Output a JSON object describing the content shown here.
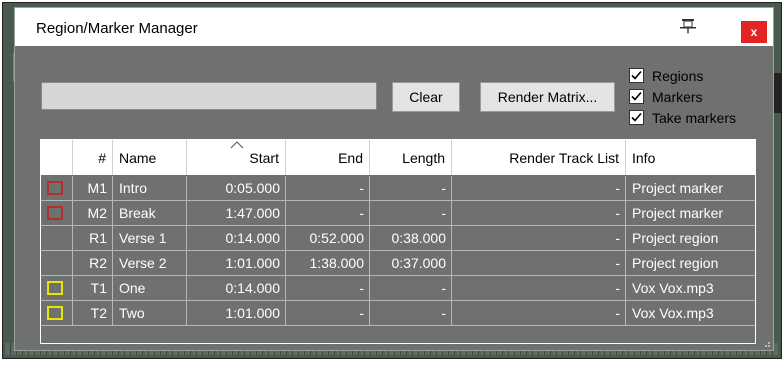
{
  "dialog": {
    "title": "Region/Marker Manager",
    "close_label": "x",
    "pin_icon": "pin-icon"
  },
  "toolbar": {
    "search_value": "",
    "clear_label": "Clear",
    "render_matrix_label": "Render Matrix..."
  },
  "filters": [
    {
      "label": "Regions",
      "checked": true
    },
    {
      "label": "Markers",
      "checked": true
    },
    {
      "label": "Take markers",
      "checked": true
    }
  ],
  "table": {
    "columns": [
      "",
      "#",
      "Name",
      "Start",
      "End",
      "Length",
      "Render Track List",
      "Info"
    ],
    "sorted_column": "Start",
    "rows": [
      {
        "swatch": "#b03030",
        "id": "M1",
        "name": "Intro",
        "start": "0:05.000",
        "end": "-",
        "length": "-",
        "render": "-",
        "info": "Project marker"
      },
      {
        "swatch": "#b03030",
        "id": "M2",
        "name": "Break",
        "start": "1:47.000",
        "end": "-",
        "length": "-",
        "render": "-",
        "info": "Project marker"
      },
      {
        "swatch": "",
        "id": "R1",
        "name": "Verse 1",
        "start": "0:14.000",
        "end": "0:52.000",
        "length": "0:38.000",
        "render": "-",
        "info": "Project region"
      },
      {
        "swatch": "",
        "id": "R2",
        "name": "Verse 2",
        "start": "1:01.000",
        "end": "1:38.000",
        "length": "0:37.000",
        "render": "-",
        "info": "Project region"
      },
      {
        "swatch": "#e6e600",
        "id": "T1",
        "name": "One",
        "start": "0:14.000",
        "end": "-",
        "length": "-",
        "render": "-",
        "info": "Vox Vox.mp3"
      },
      {
        "swatch": "#e6e600",
        "id": "T2",
        "name": "Two",
        "start": "1:01.000",
        "end": "-",
        "length": "-",
        "render": "-",
        "info": "Vox Vox.mp3"
      }
    ]
  },
  "colors": {
    "row_bg": "#6e716f",
    "close_bg": "#e32424"
  }
}
